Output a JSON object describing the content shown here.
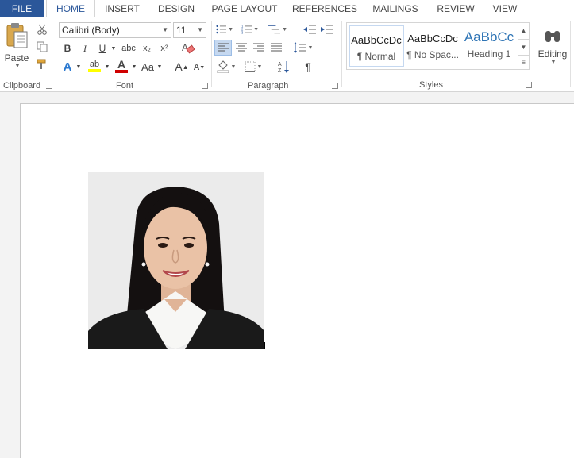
{
  "tabs": [
    {
      "label": "FILE"
    },
    {
      "label": "HOME"
    },
    {
      "label": "INSERT"
    },
    {
      "label": "DESIGN"
    },
    {
      "label": "PAGE LAYOUT"
    },
    {
      "label": "REFERENCES"
    },
    {
      "label": "MAILINGS"
    },
    {
      "label": "REVIEW"
    },
    {
      "label": "VIEW"
    }
  ],
  "clipboard": {
    "paste_label": "Paste",
    "group_label": "Clipboard"
  },
  "font": {
    "font_name": "Calibri (Body)",
    "font_size": "11",
    "group_label": "Font",
    "bold": "B",
    "italic": "I",
    "underline": "U",
    "strike": "abc",
    "subscript": "x₂",
    "superscript": "x²",
    "text_effects": "A",
    "highlight": "ab",
    "font_color": "A",
    "change_case": "Aa",
    "grow": "A",
    "shrink": "A",
    "highlight_color": "#ffff00",
    "font_color_value": "#d00000"
  },
  "paragraph": {
    "group_label": "Paragraph",
    "pilcrow": "¶"
  },
  "styles": {
    "group_label": "Styles",
    "items": [
      {
        "preview": "AaBbCcDc",
        "name": "¶ Normal"
      },
      {
        "preview": "AaBbCcDc",
        "name": "¶ No Spac..."
      },
      {
        "preview": "AaBbCc",
        "name": "Heading 1"
      }
    ],
    "heading_color": "#2e74b5"
  },
  "editing": {
    "label": "Editing"
  },
  "colors": {
    "accent": "#2b579a"
  }
}
